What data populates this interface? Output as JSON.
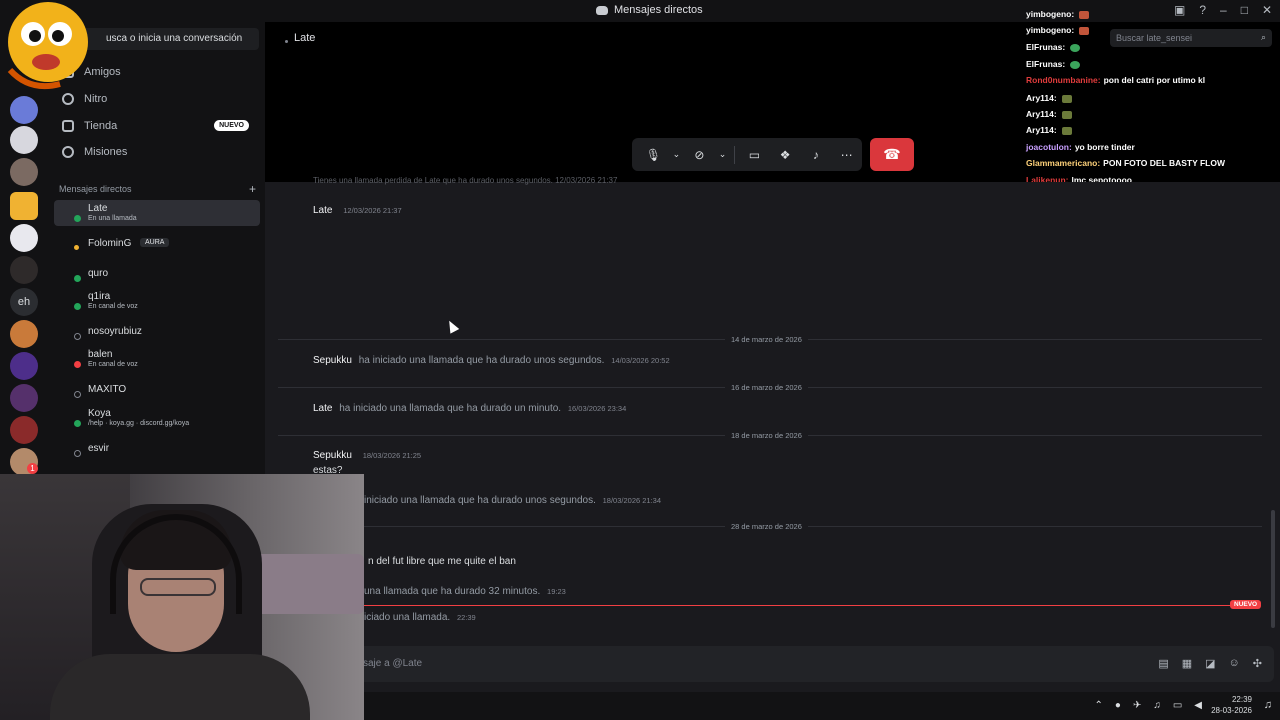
{
  "window": {
    "title": "Mensajes directos"
  },
  "sidebar": {
    "search_placeholder": "usca o inicia una conversación",
    "nav": [
      {
        "label": "Amigos"
      },
      {
        "label": "Nitro"
      },
      {
        "label": "Tienda",
        "badge": "NUEVO"
      },
      {
        "label": "Misiones"
      }
    ],
    "dm_header": "Mensajes directos",
    "dms": [
      {
        "name": "Late",
        "sub": "En una llamada",
        "status": "online"
      },
      {
        "name": "FolominG",
        "tag": "AURA",
        "status": "idle"
      },
      {
        "name": "quro",
        "status": "online"
      },
      {
        "name": "q1ira",
        "sub": "En canal de voz",
        "status": "online"
      },
      {
        "name": "nosoyrubiuz",
        "status": "offline"
      },
      {
        "name": "balen",
        "sub": "En canal de voz",
        "status": "dnd"
      },
      {
        "name": "MAXITO",
        "status": "offline"
      },
      {
        "name": "Koya",
        "sub": "/help · koya.gg · discord.gg/koya",
        "status": "online"
      },
      {
        "name": "esvir",
        "status": "offline"
      }
    ],
    "servers": [
      "eh"
    ],
    "mention_badge": "1"
  },
  "call": {
    "user": "Late",
    "controls": [
      "mic-icon",
      "chevron-down-icon",
      "camera-off-icon",
      "chevron-down-icon",
      "screen-share-icon",
      "activities-icon",
      "soundboard-icon",
      "more-icon"
    ],
    "hangup_color": "#da373c"
  },
  "chat_overlay": {
    "search_placeholder": "Buscar late_sensei",
    "lines": [
      {
        "user": "yimbogeno:",
        "text": "",
        "color": "#ffffff"
      },
      {
        "user": "yimbogeno:",
        "text": "",
        "color": "#ffffff"
      },
      {
        "user": "ElFrunas:",
        "text": "",
        "color": "#ffffff"
      },
      {
        "user": "ElFrunas:",
        "text": "",
        "color": "#ffffff"
      },
      {
        "user": "Rond0numbanine:",
        "text": "pon del catri por utimo kl",
        "color": "#e03c3c"
      },
      {
        "user": "Ary114:",
        "text": "",
        "color": "#ffffff"
      },
      {
        "user": "Ary114:",
        "text": "",
        "color": "#ffffff"
      },
      {
        "user": "Ary114:",
        "text": "",
        "color": "#ffffff"
      },
      {
        "user": "joacotulon:",
        "text": "yo borre tinder",
        "color": "#c9a0ff"
      },
      {
        "user": "Glammamericano:",
        "text": "PON FOTO DEL BASTY FLOW",
        "color": "#ffd27a"
      },
      {
        "user": "Lalikenun:",
        "text": "lmc sepotoooo",
        "color": "#e03c3c"
      }
    ]
  },
  "messages": {
    "truncated_top": "Tienes una llamada perdida de Late que ha durado unos segundos. 12/03/2026 21:37",
    "first": {
      "author": "Late",
      "time": "12/03/2026 21:37"
    },
    "dates": [
      "14 de marzo de 2026",
      "16 de marzo de 2026",
      "18 de marzo de 2026",
      "28 de marzo de 2026"
    ],
    "calls": [
      {
        "author": "Sepukku",
        "text": "ha iniciado una llamada que ha durado unos segundos.",
        "time": "14/03/2026 20:52"
      },
      {
        "author": "Late",
        "text": "ha iniciado una llamada que ha durado un minuto.",
        "time": "16/03/2026 23:34"
      }
    ],
    "sepukku_msg": {
      "author": "Sepukku",
      "time": "18/03/2026 21:25",
      "text": "estas?"
    },
    "partial": [
      {
        "text": "iniciado una llamada que ha durado unos segundos.",
        "time": "18/03/2026 21:34"
      },
      {
        "text": "n del fut libre que me quite el ban",
        "time": ""
      },
      {
        "text": "una llamada que ha durado 32 minutos.",
        "time": "19:23"
      },
      {
        "text": "iciado una llamada.",
        "time": "22:39"
      }
    ],
    "new_label": "NUEVO"
  },
  "composer": {
    "placeholder": "saje a @Late"
  },
  "taskbar": {
    "time": "22:39",
    "date": "28-03-2026"
  }
}
